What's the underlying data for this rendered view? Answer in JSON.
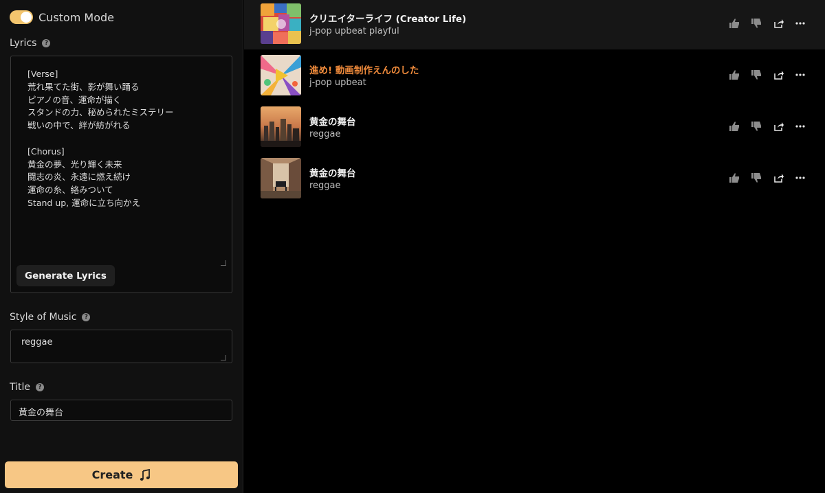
{
  "custom_mode": {
    "label": "Custom Mode",
    "enabled": true
  },
  "lyrics": {
    "label": "Lyrics",
    "text": "[Verse]\n荒れ果てた街、影が舞い踊る\nピアノの音、運命が描く\nスタンドの力、秘められたミステリー\n戦いの中で、絆が紡がれる\n\n[Chorus]\n黄金の夢、光り輝く未来\n闘志の炎、永遠に燃え続け\n運命の糸、絡みついて\nStand up, 運命に立ち向かえ",
    "generate_button": "Generate Lyrics"
  },
  "style": {
    "label": "Style of Music",
    "value": "reggae"
  },
  "title": {
    "label": "Title",
    "value": "黄金の舞台"
  },
  "create_button": "Create",
  "songs": [
    {
      "title": "クリエイターライフ (Creator Life)",
      "tags": "j-pop upbeat playful",
      "highlight": false
    },
    {
      "title": "進め! 動画制作えんのした",
      "tags": "j-pop upbeat",
      "highlight": true
    },
    {
      "title": "黄金の舞台",
      "tags": "reggae",
      "highlight": false
    },
    {
      "title": "黄金の舞台",
      "tags": "reggae",
      "highlight": false
    }
  ],
  "colors": {
    "accent": "#f7c785",
    "highlight_title": "#f28c3c",
    "toggle_on": "#f3c56e"
  },
  "icons": {
    "help": "question-circle",
    "like": "thumbs-up",
    "dislike": "thumbs-down",
    "share": "share",
    "more": "ellipsis",
    "music": "music-note"
  }
}
